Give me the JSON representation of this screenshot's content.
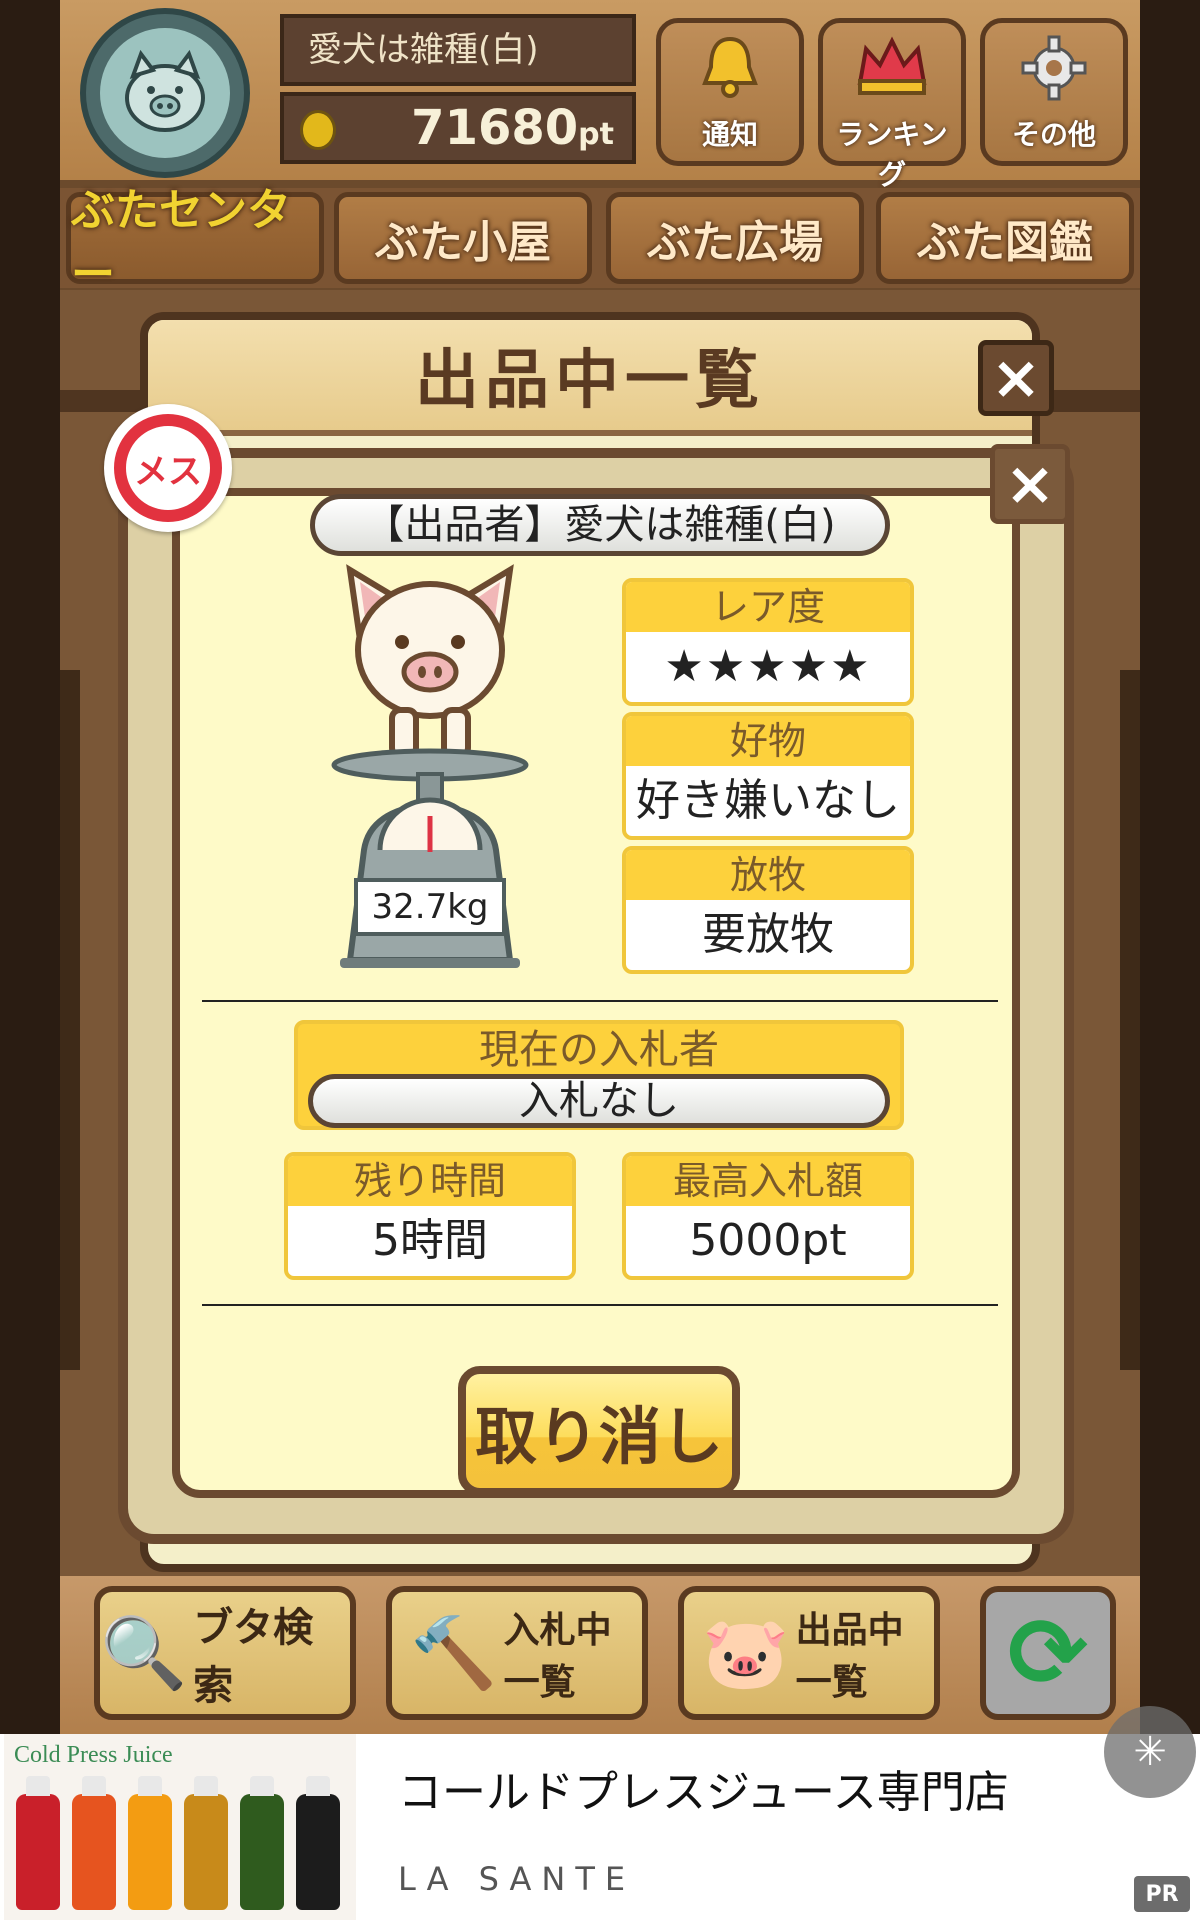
{
  "header": {
    "user_name": "愛犬は雑種(白)",
    "points_value": "71680",
    "points_unit": "pt",
    "buttons": [
      {
        "label": "通知",
        "icon": "bell-icon"
      },
      {
        "label": "ランキング",
        "icon": "crown-icon"
      },
      {
        "label": "その他",
        "icon": "gear-icon"
      }
    ]
  },
  "tabs": [
    {
      "label": "ぶたセンター",
      "active": true
    },
    {
      "label": "ぶた小屋",
      "active": false
    },
    {
      "label": "ぶた広場",
      "active": false
    },
    {
      "label": "ぶた図鑑",
      "active": false
    }
  ],
  "list_panel": {
    "title": "出品中一覧",
    "close_label": "×"
  },
  "detail": {
    "close_label": "×",
    "gender_badge": "メス",
    "seller": "【出品者】愛犬は雑種(白)",
    "weight": "32.7kg",
    "rarity_label": "レア度",
    "rarity_stars": "★★★★★",
    "rarity_value": 5,
    "favorite_label": "好物",
    "favorite_value": "好き嫌いなし",
    "grazing_label": "放牧",
    "grazing_value": "要放牧",
    "bidder_label": "現在の入札者",
    "bidder_value": "入札なし",
    "time_left_label": "残り時間",
    "time_left_value": "5時間",
    "max_bid_label": "最高入札額",
    "max_bid_value": "5000pt",
    "cancel_label": "取り消し"
  },
  "bottom_bar": [
    {
      "label": "ブタ検索",
      "icon": "magnifier-icon"
    },
    {
      "label": "入札中一覧",
      "icon": "gavel-icon"
    },
    {
      "label": "出品中一覧",
      "icon": "pig-face-icon"
    }
  ],
  "ad": {
    "image_brand": "Cold Press Juice",
    "title": "コールドプレスジュース専門店",
    "sponsor": "LA SANTE",
    "pr_label": "PR"
  },
  "colors": {
    "accent_yellow": "#fdd13c",
    "wood_brown": "#6b4a30",
    "panel_cream": "#fefac8",
    "star_pink": "#e9707a",
    "female_red": "#e2323f"
  }
}
